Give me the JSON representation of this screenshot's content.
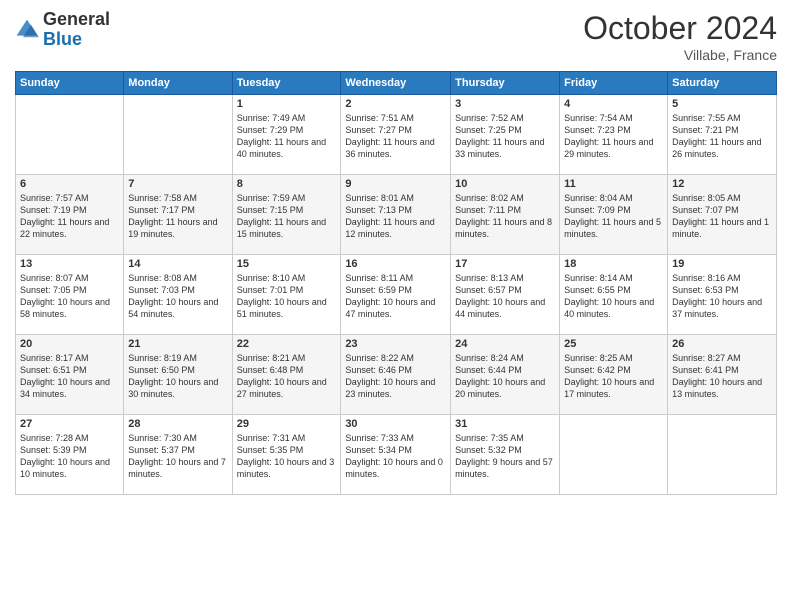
{
  "logo": {
    "general": "General",
    "blue": "Blue"
  },
  "title": "October 2024",
  "location": "Villabe, France",
  "days_header": [
    "Sunday",
    "Monday",
    "Tuesday",
    "Wednesday",
    "Thursday",
    "Friday",
    "Saturday"
  ],
  "weeks": [
    [
      {
        "day": "",
        "info": ""
      },
      {
        "day": "",
        "info": ""
      },
      {
        "day": "1",
        "info": "Sunrise: 7:49 AM\nSunset: 7:29 PM\nDaylight: 11 hours and 40 minutes."
      },
      {
        "day": "2",
        "info": "Sunrise: 7:51 AM\nSunset: 7:27 PM\nDaylight: 11 hours and 36 minutes."
      },
      {
        "day": "3",
        "info": "Sunrise: 7:52 AM\nSunset: 7:25 PM\nDaylight: 11 hours and 33 minutes."
      },
      {
        "day": "4",
        "info": "Sunrise: 7:54 AM\nSunset: 7:23 PM\nDaylight: 11 hours and 29 minutes."
      },
      {
        "day": "5",
        "info": "Sunrise: 7:55 AM\nSunset: 7:21 PM\nDaylight: 11 hours and 26 minutes."
      }
    ],
    [
      {
        "day": "6",
        "info": "Sunrise: 7:57 AM\nSunset: 7:19 PM\nDaylight: 11 hours and 22 minutes."
      },
      {
        "day": "7",
        "info": "Sunrise: 7:58 AM\nSunset: 7:17 PM\nDaylight: 11 hours and 19 minutes."
      },
      {
        "day": "8",
        "info": "Sunrise: 7:59 AM\nSunset: 7:15 PM\nDaylight: 11 hours and 15 minutes."
      },
      {
        "day": "9",
        "info": "Sunrise: 8:01 AM\nSunset: 7:13 PM\nDaylight: 11 hours and 12 minutes."
      },
      {
        "day": "10",
        "info": "Sunrise: 8:02 AM\nSunset: 7:11 PM\nDaylight: 11 hours and 8 minutes."
      },
      {
        "day": "11",
        "info": "Sunrise: 8:04 AM\nSunset: 7:09 PM\nDaylight: 11 hours and 5 minutes."
      },
      {
        "day": "12",
        "info": "Sunrise: 8:05 AM\nSunset: 7:07 PM\nDaylight: 11 hours and 1 minute."
      }
    ],
    [
      {
        "day": "13",
        "info": "Sunrise: 8:07 AM\nSunset: 7:05 PM\nDaylight: 10 hours and 58 minutes."
      },
      {
        "day": "14",
        "info": "Sunrise: 8:08 AM\nSunset: 7:03 PM\nDaylight: 10 hours and 54 minutes."
      },
      {
        "day": "15",
        "info": "Sunrise: 8:10 AM\nSunset: 7:01 PM\nDaylight: 10 hours and 51 minutes."
      },
      {
        "day": "16",
        "info": "Sunrise: 8:11 AM\nSunset: 6:59 PM\nDaylight: 10 hours and 47 minutes."
      },
      {
        "day": "17",
        "info": "Sunrise: 8:13 AM\nSunset: 6:57 PM\nDaylight: 10 hours and 44 minutes."
      },
      {
        "day": "18",
        "info": "Sunrise: 8:14 AM\nSunset: 6:55 PM\nDaylight: 10 hours and 40 minutes."
      },
      {
        "day": "19",
        "info": "Sunrise: 8:16 AM\nSunset: 6:53 PM\nDaylight: 10 hours and 37 minutes."
      }
    ],
    [
      {
        "day": "20",
        "info": "Sunrise: 8:17 AM\nSunset: 6:51 PM\nDaylight: 10 hours and 34 minutes."
      },
      {
        "day": "21",
        "info": "Sunrise: 8:19 AM\nSunset: 6:50 PM\nDaylight: 10 hours and 30 minutes."
      },
      {
        "day": "22",
        "info": "Sunrise: 8:21 AM\nSunset: 6:48 PM\nDaylight: 10 hours and 27 minutes."
      },
      {
        "day": "23",
        "info": "Sunrise: 8:22 AM\nSunset: 6:46 PM\nDaylight: 10 hours and 23 minutes."
      },
      {
        "day": "24",
        "info": "Sunrise: 8:24 AM\nSunset: 6:44 PM\nDaylight: 10 hours and 20 minutes."
      },
      {
        "day": "25",
        "info": "Sunrise: 8:25 AM\nSunset: 6:42 PM\nDaylight: 10 hours and 17 minutes."
      },
      {
        "day": "26",
        "info": "Sunrise: 8:27 AM\nSunset: 6:41 PM\nDaylight: 10 hours and 13 minutes."
      }
    ],
    [
      {
        "day": "27",
        "info": "Sunrise: 7:28 AM\nSunset: 5:39 PM\nDaylight: 10 hours and 10 minutes."
      },
      {
        "day": "28",
        "info": "Sunrise: 7:30 AM\nSunset: 5:37 PM\nDaylight: 10 hours and 7 minutes."
      },
      {
        "day": "29",
        "info": "Sunrise: 7:31 AM\nSunset: 5:35 PM\nDaylight: 10 hours and 3 minutes."
      },
      {
        "day": "30",
        "info": "Sunrise: 7:33 AM\nSunset: 5:34 PM\nDaylight: 10 hours and 0 minutes."
      },
      {
        "day": "31",
        "info": "Sunrise: 7:35 AM\nSunset: 5:32 PM\nDaylight: 9 hours and 57 minutes."
      },
      {
        "day": "",
        "info": ""
      },
      {
        "day": "",
        "info": ""
      }
    ]
  ]
}
